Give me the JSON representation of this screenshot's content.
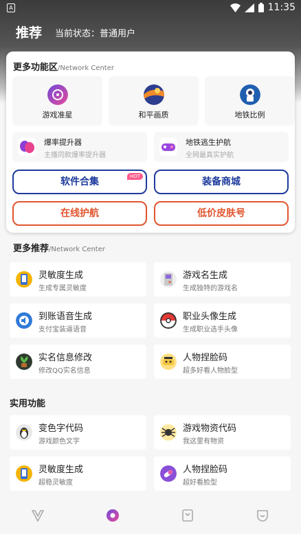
{
  "status_bar": {
    "app_badge": "A",
    "time": "11:35"
  },
  "header": {
    "title": "推荐",
    "status": "当前状态：普通用户"
  },
  "more_functions": {
    "title": "更多功能区",
    "subtitle": "/Network Center",
    "tiles": [
      {
        "label": "游戏准星",
        "icon": "crosshair-icon"
      },
      {
        "label": "和平画质",
        "icon": "graphics-icon"
      },
      {
        "label": "地铁比例",
        "icon": "astronaut-icon"
      }
    ],
    "wide_items": [
      {
        "title": "爆率提升器",
        "desc": "主播同款爆率提升器",
        "icon": "masks-icon"
      },
      {
        "title": "地铁逃生护航",
        "desc": "全网最真实护航",
        "icon": "gamepad-icon"
      }
    ],
    "buttons": [
      {
        "label": "软件合集",
        "badge": "HOT"
      },
      {
        "label": "装备商城"
      },
      {
        "label": "在线护航"
      },
      {
        "label": "低价皮肤号"
      }
    ]
  },
  "more_recommend": {
    "title": "更多推荐",
    "subtitle": "/Network Center",
    "items": [
      {
        "title": "灵敏度生成",
        "desc": "生成专属灵敏度",
        "icon": "phone-icon"
      },
      {
        "title": "游戏名生成",
        "desc": "生成独特的游戏名",
        "icon": "gameboy-icon"
      },
      {
        "title": "到账语音生成",
        "desc": "支付宝装逼语音",
        "icon": "speaker-icon"
      },
      {
        "title": "职业头像生成",
        "desc": "生成职业选手头像",
        "icon": "pokeball-icon"
      },
      {
        "title": "实名信息修改",
        "desc": "修改QQ实名信息",
        "icon": "plant-icon"
      },
      {
        "title": "人物捏脸码",
        "desc": "超多好看人物脸型",
        "icon": "face-icon"
      }
    ]
  },
  "utilities": {
    "title": "实用功能",
    "items": [
      {
        "title": "变色字代码",
        "desc": "游戏颜色文字",
        "icon": "penguin-icon"
      },
      {
        "title": "游戏物资代码",
        "desc": "我这里有物资",
        "icon": "spider-icon"
      },
      {
        "title": "灵敏度生成",
        "desc": "超稳灵敏度",
        "icon": "phone-icon"
      },
      {
        "title": "人物捏脸码",
        "desc": "超好看脸型",
        "icon": "capsule-icon"
      }
    ]
  },
  "bottom_nav": [
    {
      "name": "nav-home",
      "icon": "v-logo-icon",
      "active": false
    },
    {
      "name": "nav-recommend",
      "icon": "circle-dot-icon",
      "active": true
    },
    {
      "name": "nav-bookmark",
      "icon": "bookmark-icon",
      "active": false
    },
    {
      "name": "nav-profile",
      "icon": "smile-icon",
      "active": false
    }
  ],
  "colors": {
    "blue": "#1d3a9c",
    "red": "#e0552e",
    "hot": "#ff5a8a"
  }
}
